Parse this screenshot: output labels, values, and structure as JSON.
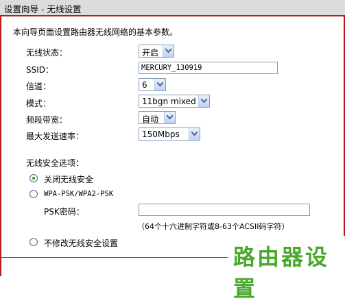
{
  "window": {
    "title": "设置向导 - 无线设置"
  },
  "intro": "本向导页面设置路由器无线网络的基本参数。",
  "fields": {
    "wireless_status": {
      "label": "无线状态：",
      "value": "开启"
    },
    "ssid": {
      "label": "SSID：",
      "value": "MERCURY_130919"
    },
    "channel": {
      "label": "信道：",
      "value": "6"
    },
    "mode": {
      "label": "模式：",
      "value": "11bgn mixed"
    },
    "bandwidth": {
      "label": "频段带宽：",
      "value": "自动"
    },
    "max_rate": {
      "label": "最大发送速率：",
      "value": "150Mbps"
    }
  },
  "security": {
    "section_label": "无线安全选项：",
    "options": [
      {
        "label": "关闭无线安全",
        "selected": true
      },
      {
        "label": "WPA-PSK/WPA2-PSK",
        "selected": false
      },
      {
        "label": "不修改无线安全设置",
        "selected": false
      }
    ],
    "psk_label": "PSK密码：",
    "psk_value": "",
    "psk_hint": "（64个十六进制字符或8-63个ACSII码字符）"
  },
  "watermark": "路由器设置",
  "colors": {
    "accent_line": "#b71c1c",
    "radio_selected": "#21a121",
    "watermark": "#4aa82b"
  }
}
